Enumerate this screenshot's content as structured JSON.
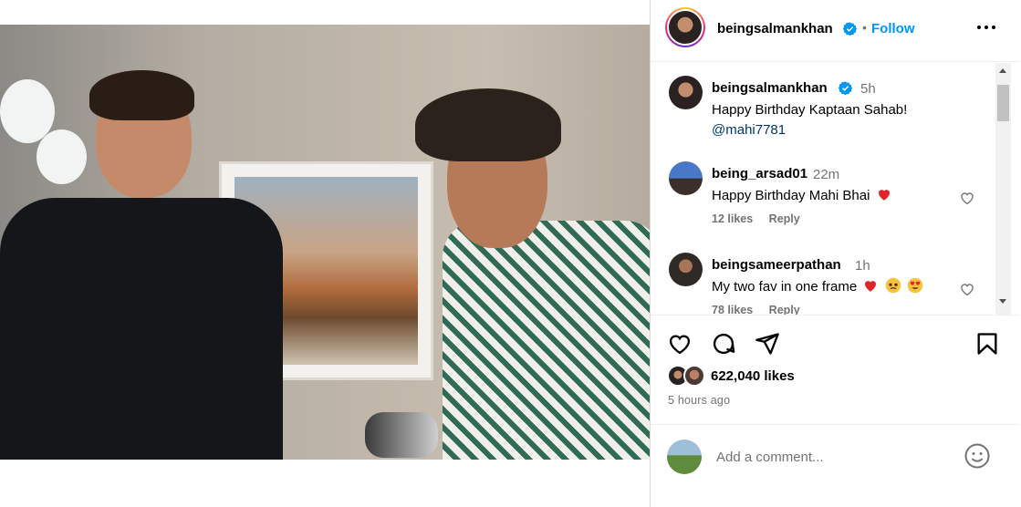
{
  "post": {
    "author": "beingsalmankhan",
    "follow_label": "Follow",
    "separator": "•",
    "caption": {
      "username": "beingsalmankhan",
      "time": "5h",
      "text": "Happy Birthday Kaptaan Sahab!",
      "mention": "@mahi7781"
    }
  },
  "comments": [
    {
      "username": "being_arsad01",
      "time": "22m",
      "text": "Happy Birthday Mahi Bhai",
      "emojis": [
        "red-heart"
      ],
      "likes": "12 likes",
      "reply": "Reply"
    },
    {
      "username": "beingsameerpathan",
      "time": "1h",
      "text": "My two fav in one frame",
      "emojis": [
        "red-heart",
        "pleading-face",
        "heart-eyes-face"
      ],
      "likes": "78 likes",
      "reply": "Reply"
    }
  ],
  "stats": {
    "likes": "622,040 likes",
    "time_ago": "5 hours ago"
  },
  "add_comment": {
    "placeholder": "Add a comment..."
  },
  "colors": {
    "accent": "#0095f6",
    "verified": "#0095f6",
    "secondary_text": "#737373",
    "heart": "#ff3040"
  },
  "icons": {
    "verified": "verified-badge-icon",
    "more": "more-options-icon",
    "like": "heart-icon",
    "comment": "comment-icon",
    "share": "share-icon",
    "save": "bookmark-icon",
    "emoji": "emoji-icon"
  }
}
